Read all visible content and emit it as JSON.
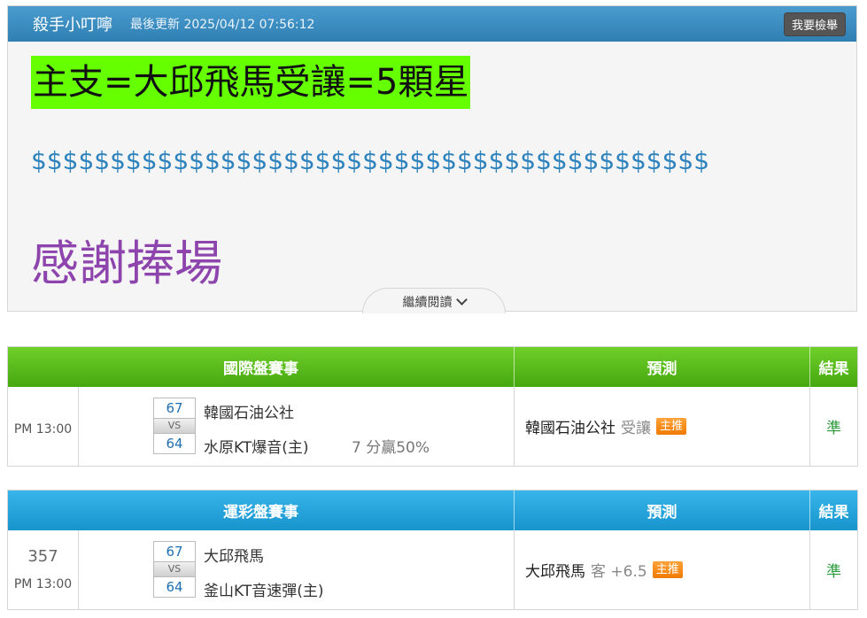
{
  "post": {
    "author": "殺手小叮嚀",
    "updated": "最後更新 2025/04/12 07:56:12",
    "report_button": "我要檢舉",
    "headline": "主支=大邱飛馬受讓=5顆星",
    "dollars": "$$$$$$$$$$$$$$$$$$$$$$$$$$$$$$$$$$$$$$$$$$$",
    "thanks": "感謝捧場",
    "read_more": "繼續閱讀"
  },
  "tables": [
    {
      "header": {
        "match": "國際盤賽事",
        "prediction": "預測",
        "result": "結果"
      },
      "header_color": "#52b81a",
      "row": {
        "game_no": "",
        "time": "PM 13:00",
        "away_score": "67",
        "vs": "VS",
        "home_score": "64",
        "away_team": "韓國石油公社",
        "home_team": "水原KT爆音(主)",
        "note": "7 分贏50%",
        "pick_team": "韓國石油公社",
        "pick_type": "受讓",
        "badge": "主推",
        "result": "準"
      }
    },
    {
      "header": {
        "match": "運彩盤賽事",
        "prediction": "預測",
        "result": "結果"
      },
      "header_color": "#22a0d6",
      "row": {
        "game_no": "357",
        "time": "PM 13:00",
        "away_score": "67",
        "vs": "VS",
        "home_score": "64",
        "away_team": "大邱飛馬",
        "home_team": "釜山KT音速彈(主)",
        "pick_team": "大邱飛馬",
        "pick_type": "客 +6.5",
        "badge": "主推",
        "result": "準"
      }
    }
  ],
  "colors": {
    "header_blue": "#3a8fc4",
    "headline_bg": "#66ff00",
    "dollars": "#2f83bd",
    "thanks": "#8e44ad",
    "badge": "#f58a10",
    "result": "#2a9a3a"
  },
  "icons": {
    "read_more": "chevron-down-icon"
  }
}
